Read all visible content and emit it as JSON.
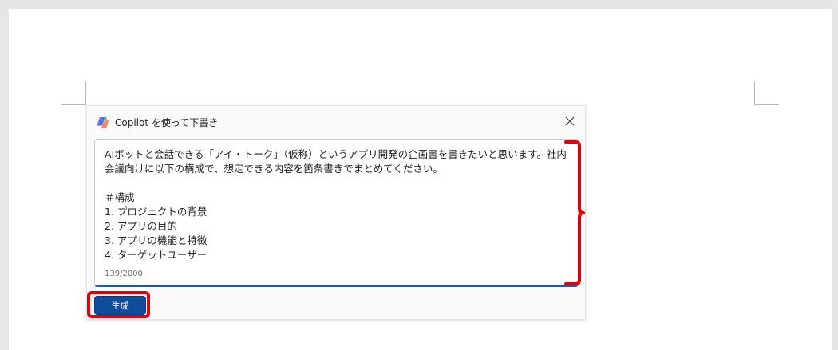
{
  "dialog": {
    "title": "Copilot を使って下書き",
    "prompt_text": "AIボットと会話できる「アイ・トーク」（仮称）というアプリ開発の企画書を書きたいと思います。社内会議向けに以下の構成で、想定できる内容を箇条書きでまとめてください。\n\n＃構成\n1. プロジェクトの背景\n2. アプリの目的\n3. アプリの機能と特徴\n4. ターゲットユーザー",
    "char_count": "139/2000",
    "generate_label": "生成"
  },
  "icons": {
    "copilot": "copilot-logo-icon",
    "close": "close-icon"
  },
  "colors": {
    "accent": "#0f4c9c",
    "highlight": "#e0000a"
  }
}
